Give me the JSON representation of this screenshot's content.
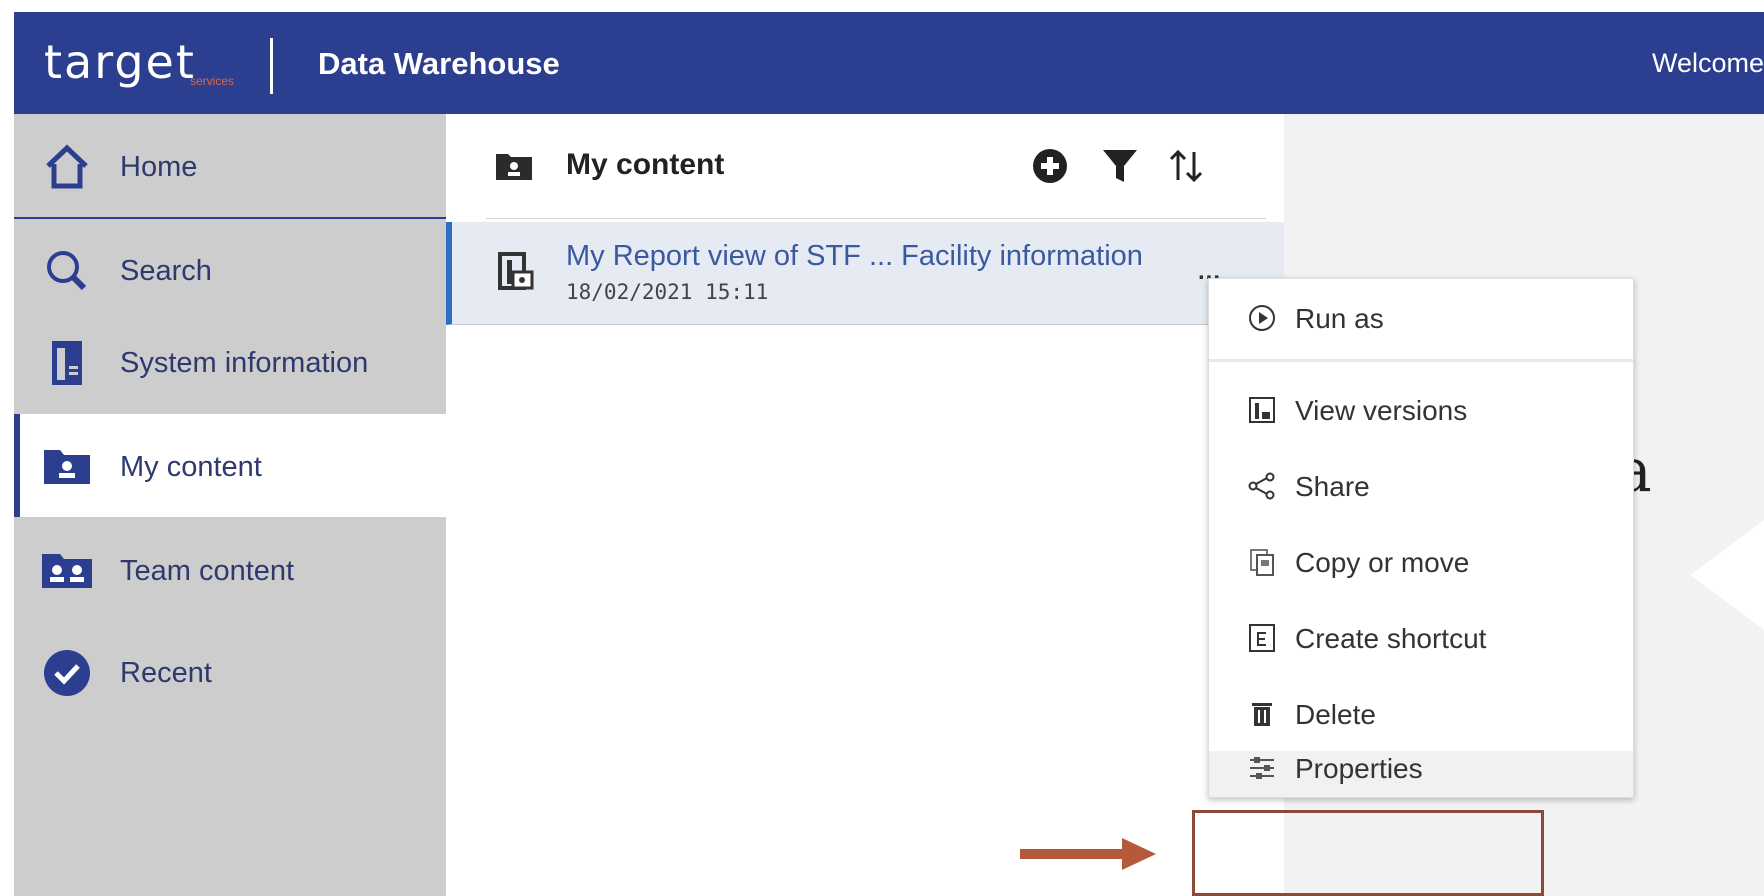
{
  "header": {
    "logo_text": "target",
    "logo_sub": "services",
    "title": "Data Warehouse",
    "welcome": "Welcome"
  },
  "sidebar": {
    "items": [
      {
        "label": "Home",
        "icon": "home-icon"
      },
      {
        "label": "Search",
        "icon": "search-icon"
      },
      {
        "label": "System information",
        "icon": "system-info-icon"
      },
      {
        "label": "My content",
        "icon": "my-content-folder-icon",
        "active": true
      },
      {
        "label": "Team content",
        "icon": "team-content-folder-icon"
      },
      {
        "label": "Recent",
        "icon": "recent-check-icon"
      }
    ]
  },
  "main": {
    "title": "My content",
    "actions": [
      "add-icon",
      "filter-icon",
      "sort-icon"
    ],
    "rows": [
      {
        "title": "My Report view of STF ... Facility information",
        "date": "18/02/2021 15:11",
        "menu": "..."
      }
    ]
  },
  "context_menu": {
    "items": [
      {
        "label": "Run as",
        "icon": "run-icon"
      },
      {
        "label": "View versions",
        "icon": "versions-icon"
      },
      {
        "label": "Share",
        "icon": "share-icon"
      },
      {
        "label": "Copy or move",
        "icon": "copy-icon"
      },
      {
        "label": "Create shortcut",
        "icon": "shortcut-icon"
      },
      {
        "label": "Delete",
        "icon": "trash-icon"
      },
      {
        "label": "Properties",
        "icon": "properties-icon"
      }
    ]
  },
  "right_panel": {
    "partial_text": "a"
  },
  "colors": {
    "brand": "#2b3e8f",
    "highlight": "#8b4a36",
    "accent": "#e2673b"
  }
}
